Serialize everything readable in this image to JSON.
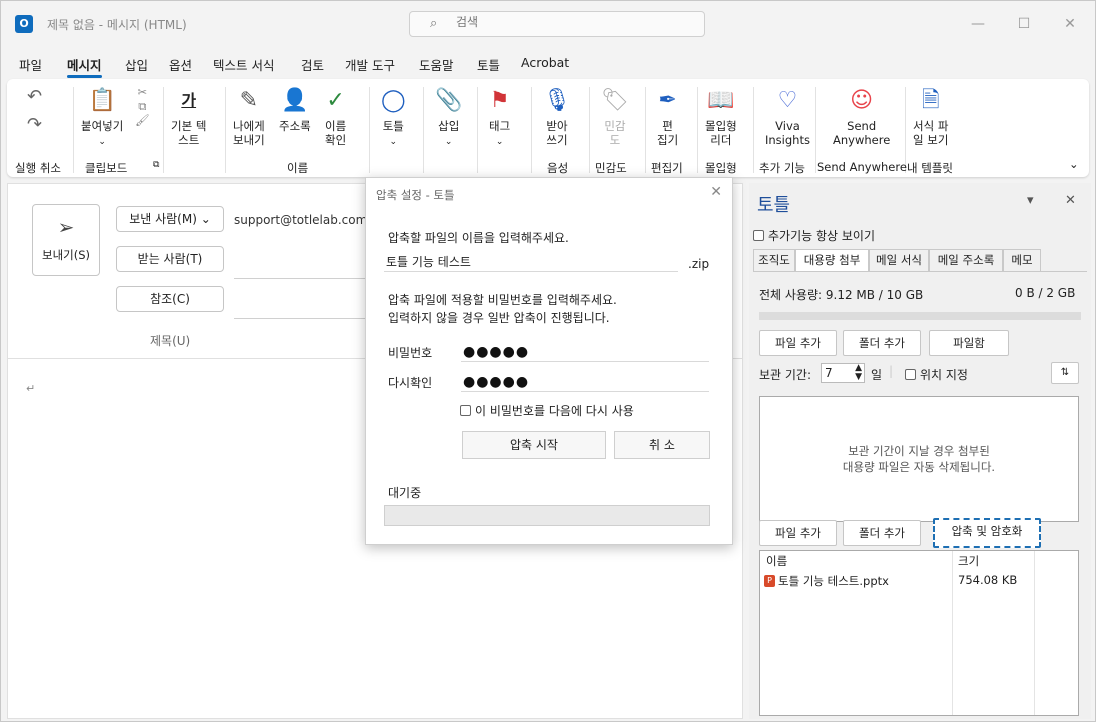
{
  "window": {
    "app_icon_letter": "O",
    "title": "제목 없음 - 메시지 (HTML)",
    "search_placeholder": "검색",
    "minimize": "—",
    "maximize": "☐",
    "close": "✕"
  },
  "menu": [
    "파일",
    "메시지",
    "삽입",
    "옵션",
    "텍스트 서식",
    "검토",
    "개발 도구",
    "도움말",
    "토틀",
    "Acrobat"
  ],
  "ribbon": {
    "undo": "실행 취소",
    "paste": "붙여넣기",
    "basic_text": "기본 텍\n스트",
    "send_to_me": "나에게\n보내기",
    "address_book": "주소록",
    "check_names": "이름\n확인",
    "totle": "토틀",
    "insert": "삽입",
    "tags": "태그",
    "dictate": "받아\n쓰기",
    "sensitivity": "민감\n도",
    "editor": "편\n집기",
    "immersive_reader": "몰입형\n리더",
    "viva_insights": "Viva\nInsights",
    "send_anywhere": "Send\nAnywhere",
    "templates": "서식 파\n일 보기",
    "groups": [
      "실행 취소",
      "클립보드",
      "이름",
      "음성",
      "민감도",
      "편집기",
      "몰입형",
      "추가 기능",
      "Send Anywhere",
      "내 템플릿"
    ]
  },
  "compose": {
    "send_label": "보내기(S)",
    "from_label": "보낸 사람(M)",
    "from_value": "support@totlelab.com",
    "to_label": "받는 사람(T)",
    "cc_label": "참조(C)",
    "subject_label": "제목(U)",
    "body_caret": "↵"
  },
  "dialog": {
    "title": "압축 설정 - 토틀",
    "filename_prompt": "압축할 파일의 이름을 입력해주세요.",
    "filename_value": "토틀 기능 테스트",
    "extension": ".zip",
    "password_prompt_1": "압축 파일에 적용할 비밀번호를 입력해주세요.",
    "password_prompt_2": "입력하지 않을 경우 일반 압축이 진행됩니다.",
    "password_label": "비밀번호",
    "password_value": "●●●●●",
    "confirm_label": "다시확인",
    "confirm_value": "●●●●●",
    "reuse_checkbox": "이 비밀번호를 다음에 다시 사용",
    "start_button": "압축 시작",
    "cancel_button": "취 소",
    "status": "대기중",
    "progress": 0
  },
  "pane": {
    "title": "토틀",
    "always_show": "추가기능 항상 보이기",
    "tabs": [
      "조직도",
      "대용량 첨부",
      "메일 서식",
      "메일 주소록",
      "메모"
    ],
    "active_tab": "대용량 첨부",
    "total_usage": "전체 사용량: 9.12 MB / 10 GB",
    "usage_right": "0 B / 2 GB",
    "add_file": "파일 추가",
    "add_folder": "폴더 추가",
    "file_box": "파일함",
    "retention_label": "보관 기간:",
    "retention_value": "7",
    "retention_unit": "일",
    "set_location": "위치 지정",
    "info_line_1": "보관 기간이 지날 경우 첨부된",
    "info_line_2": "대용량 파일은 자동 삭제됩니다.",
    "add_file_2": "파일 추가",
    "add_folder_2": "폴더 추가",
    "compress_encrypt": "압축 및 암호화",
    "col_name": "이름",
    "col_size": "크기",
    "files": [
      {
        "name": "토틀 기능 테스트.pptx",
        "size": "754.08 KB"
      }
    ]
  }
}
